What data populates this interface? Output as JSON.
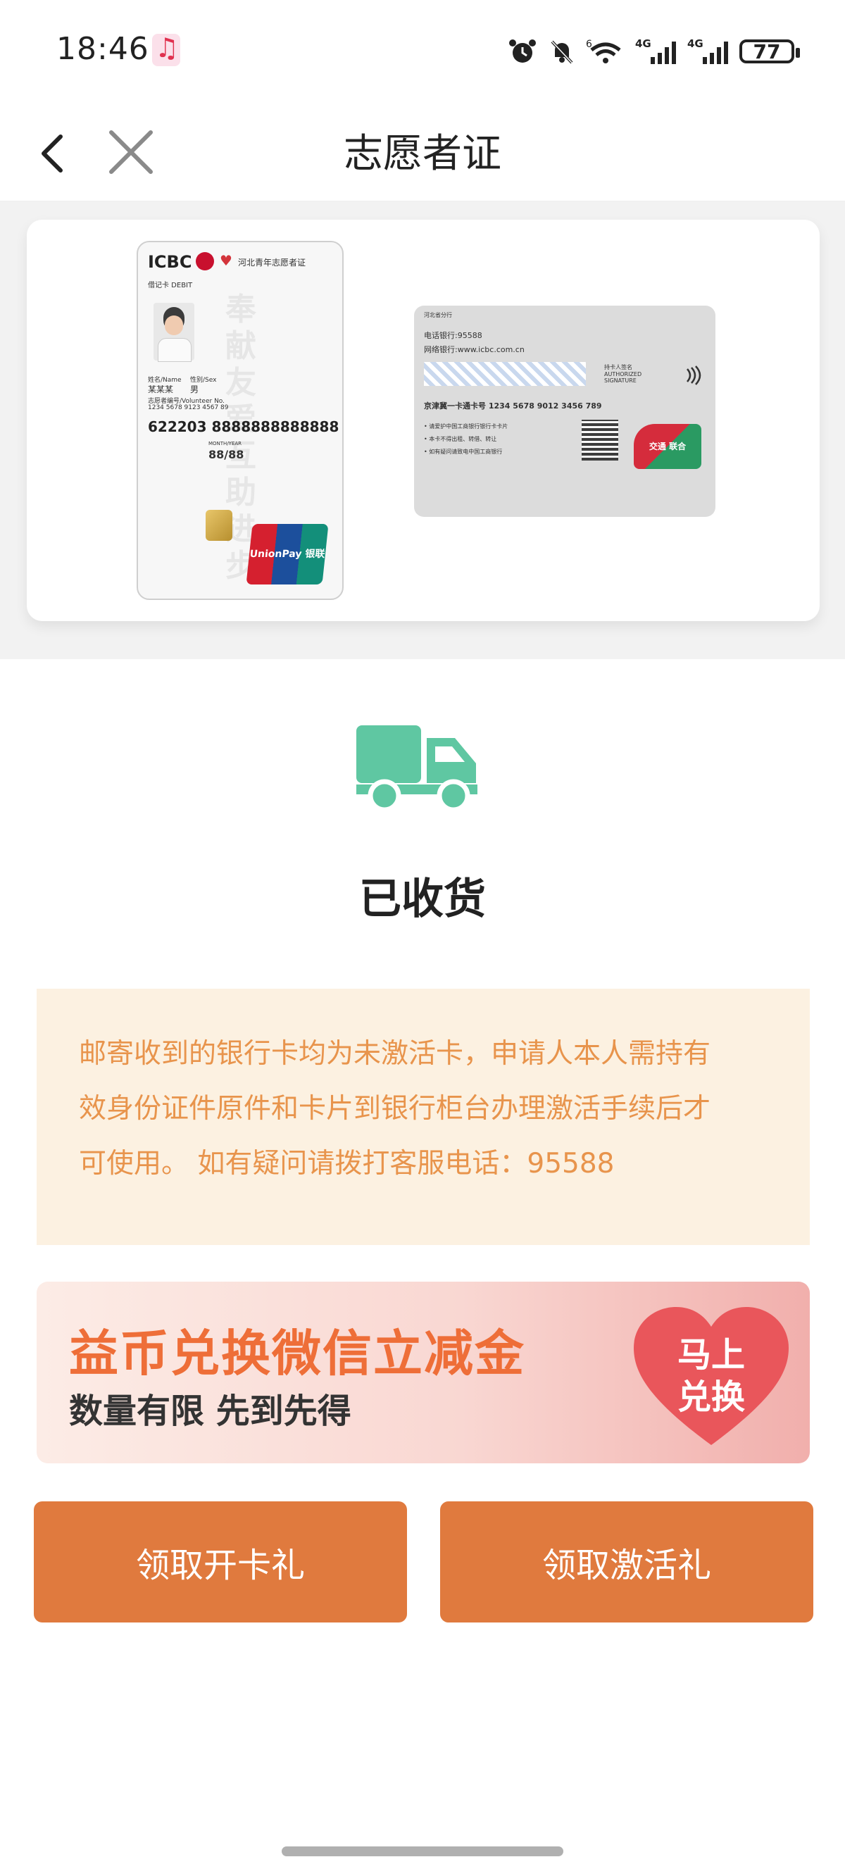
{
  "status_bar": {
    "time": "18:46",
    "battery": "77",
    "network_1": "4G",
    "network_2": "4G",
    "wifi_label": "6"
  },
  "nav": {
    "title": "志愿者证"
  },
  "card_front": {
    "bank_logo": "ICBC",
    "card_title": "河北青年志愿者证",
    "card_type": "借记卡 DEBIT",
    "name_label": "姓名/Name",
    "name_value": "某某某",
    "gender_label": "性别/Sex",
    "gender_value": "男",
    "volunteer_no_label": "志愿者编号/Volunteer No.",
    "volunteer_no": "1234 5678 9123 4567 89",
    "card_number": "622203 8888888888888",
    "valid_thru_label": "MONTH/YEAR",
    "valid_thru": "88/88",
    "slogan": "奉献 友爱 互助 进步",
    "network_logo": "UnionPay 银联"
  },
  "card_back": {
    "header_left": "河北省分行",
    "service_line": "电话银行:95588",
    "website_line": "网络银行:www.icbc.com.cn",
    "signature_label": "持卡人签名 AUTHORIZED SIGNATURE",
    "card_no_line": "京津冀一卡通卡号 1234 5678 9012 3456 789",
    "note_1": "• 请爱护中国工商银行银行卡卡片",
    "note_2": "• 本卡不得出租、转借、转让",
    "note_3": "• 如有疑问请致电中国工商银行",
    "logo_text": "交通 联合"
  },
  "delivery": {
    "status": "已收货",
    "icon": "truck-icon"
  },
  "notice": {
    "line_1": "邮寄收到的银行卡均为未激活卡，申请人本人需持有",
    "line_2": "效身份证件原件和卡片到银行柜台办理激活手续后才",
    "line_3": "可使用。 如有疑问请拨打客服电话：95588"
  },
  "banner": {
    "title": "益币兑换微信立减金",
    "subtitle": "数量有限  先到先得",
    "heart_line_1": "马上",
    "heart_line_2": "兑换"
  },
  "buttons": {
    "left": "领取开卡礼",
    "right": "领取激活礼"
  },
  "colors": {
    "accent": "#e07a3e",
    "truck": "#5fc7a2",
    "notice_bg": "#fcf1e1",
    "notice_text": "#e8944c",
    "heart": "#e9565b"
  }
}
